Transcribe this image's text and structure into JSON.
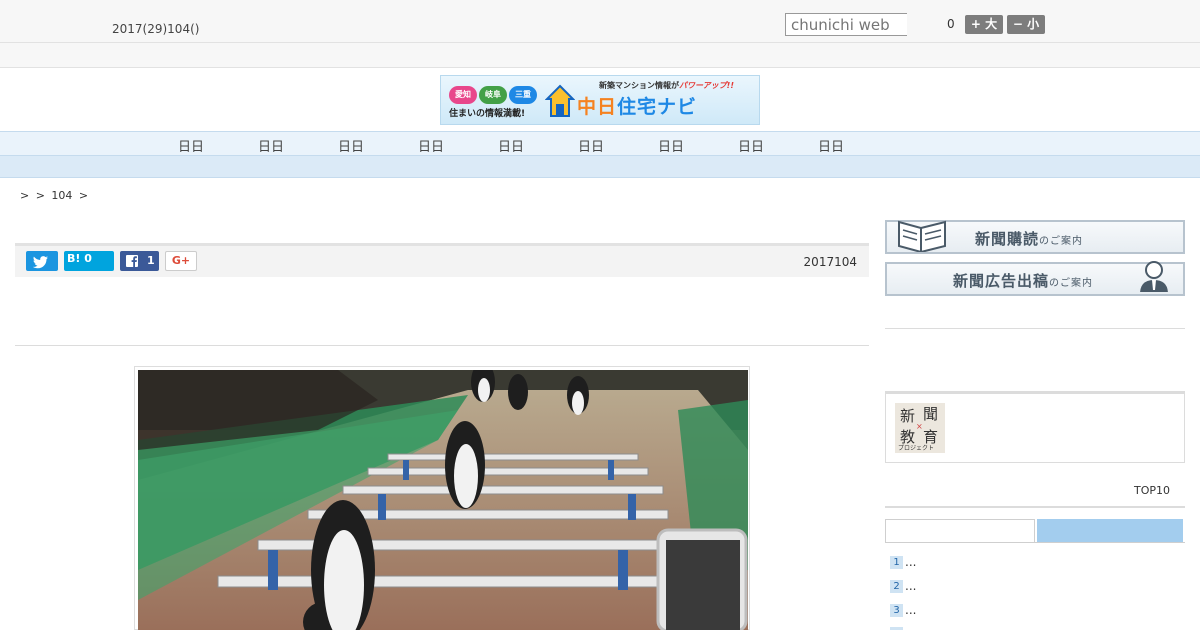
{
  "header": {
    "date": "2017(29)104()",
    "search_placeholder": "chunichi web",
    "count": "0",
    "font_large_label": "+ 大",
    "font_small_label": "− 小"
  },
  "banner": {
    "tag1": "愛知",
    "tag2": "岐阜",
    "tag3": "三重",
    "tagline": "住まいの情報満載!",
    "name_part1": "中日",
    "name_part2": "住宅ナビ",
    "sub": "新築マンション情報が",
    "sub_emphasis": "パワーアップ!!"
  },
  "nav": {
    "items": [
      "日日",
      "日日",
      "日日",
      "日日",
      "日日",
      "日日",
      "日日",
      "日日",
      "日日"
    ]
  },
  "breadcrumb": ">  > 104 >",
  "share": {
    "hatena_label": "B! 0",
    "facebook_count": "1",
    "gplus_label": "G+",
    "article_date": "2017104"
  },
  "sidebar": {
    "ad1_main": "新聞購読",
    "ad1_small": "のご案内",
    "ad2_main": "新聞広告出稿",
    "ad2_small": "のご案内",
    "np_k1": "新",
    "np_k2": "聞",
    "np_k3": "教",
    "np_k4": "育",
    "np_x": "×",
    "np_project": "プロジェクト",
    "top10_label": "TOP10",
    "ranking": [
      {
        "num": "1",
        "text": "..."
      },
      {
        "num": "2",
        "text": "..."
      },
      {
        "num": "3",
        "text": "..."
      }
    ]
  },
  "colors": {
    "twitter": "#1b95e0",
    "hatena": "#00a4de",
    "facebook": "#3b5998",
    "nav_bg": "#eaf3fb",
    "tab_active": "#a3cdee"
  }
}
